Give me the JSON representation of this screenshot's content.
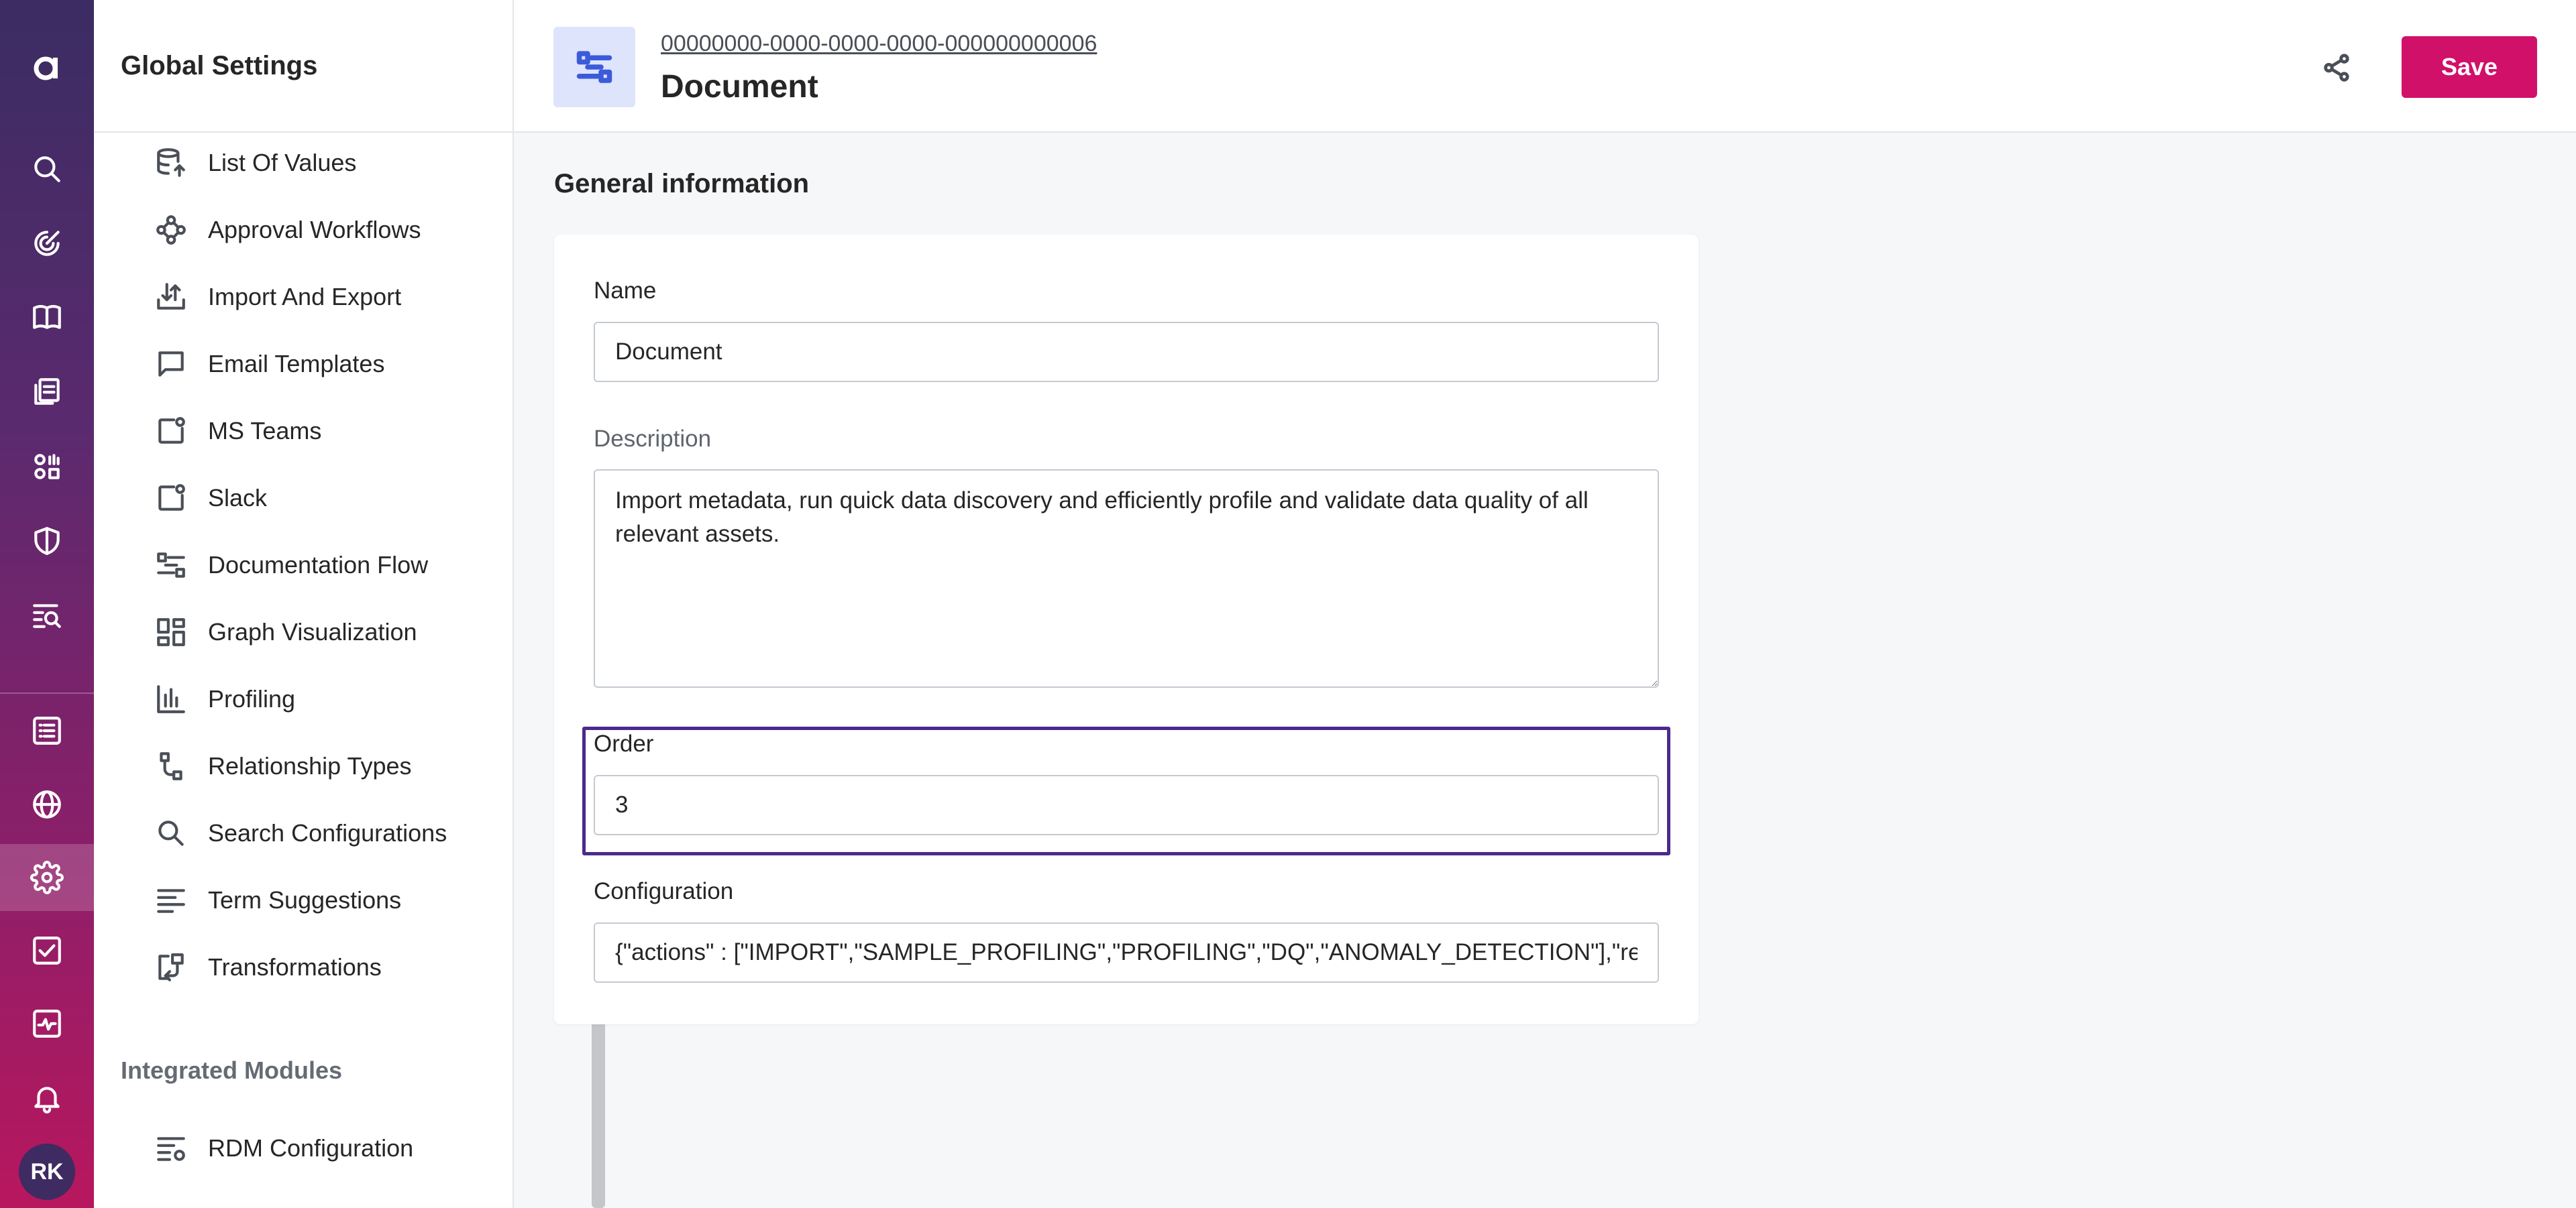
{
  "rail": {
    "logo_letter": "a",
    "icons": [
      "search-icon",
      "target-icon",
      "book-icon",
      "documents-icon",
      "catalog-icon",
      "shield-icon",
      "search-list-icon",
      "list-icon",
      "globe-icon",
      "gear-icon",
      "checkbox-icon",
      "monitor-icon",
      "bell-icon"
    ],
    "active_icon": "gear-icon",
    "avatar_initials": "RK"
  },
  "sidebar": {
    "title": "Global Settings",
    "items": [
      {
        "label": "List Of Values",
        "icon": "database-icon"
      },
      {
        "label": "Approval Workflows",
        "icon": "workflow-icon"
      },
      {
        "label": "Import And Export",
        "icon": "import-export-icon"
      },
      {
        "label": "Email Templates",
        "icon": "chat-icon"
      },
      {
        "label": "MS Teams",
        "icon": "notification-box-icon"
      },
      {
        "label": "Slack",
        "icon": "notification-box-icon"
      },
      {
        "label": "Documentation Flow",
        "icon": "flow-icon"
      },
      {
        "label": "Graph Visualization",
        "icon": "grid-icon"
      },
      {
        "label": "Profiling",
        "icon": "bar-chart-icon"
      },
      {
        "label": "Relationship Types",
        "icon": "relationship-icon"
      },
      {
        "label": "Search Configurations",
        "icon": "search-icon"
      },
      {
        "label": "Term Suggestions",
        "icon": "text-lines-icon"
      },
      {
        "label": "Transformations",
        "icon": "transform-icon"
      }
    ],
    "section_label": "Integrated Modules",
    "module_items": [
      {
        "label": "RDM Configuration",
        "icon": "list-settings-icon"
      }
    ]
  },
  "header": {
    "id": "00000000-0000-0000-0000-000000000006",
    "title": "Document",
    "save_label": "Save",
    "share_icon": "share-icon"
  },
  "main": {
    "section_title": "General information",
    "name": {
      "label": "Name",
      "value": "Document"
    },
    "description": {
      "label": "Description",
      "value": "Import metadata, run quick data discovery and efficiently profile and validate data quality of all relevant assets."
    },
    "order": {
      "label": "Order",
      "value": "3"
    },
    "configuration": {
      "label": "Configuration",
      "value": "{\"actions\" : [\"IMPORT\",\"SAMPLE_PROFILING\",\"PROFILING\",\"DQ\",\"ANOMALY_DETECTION\"],\"referenceI"
    }
  },
  "colors": {
    "brand_pink": "#d1106a",
    "focus_purple": "#4b2a8c",
    "icon_blue": "#3b5bdb"
  }
}
